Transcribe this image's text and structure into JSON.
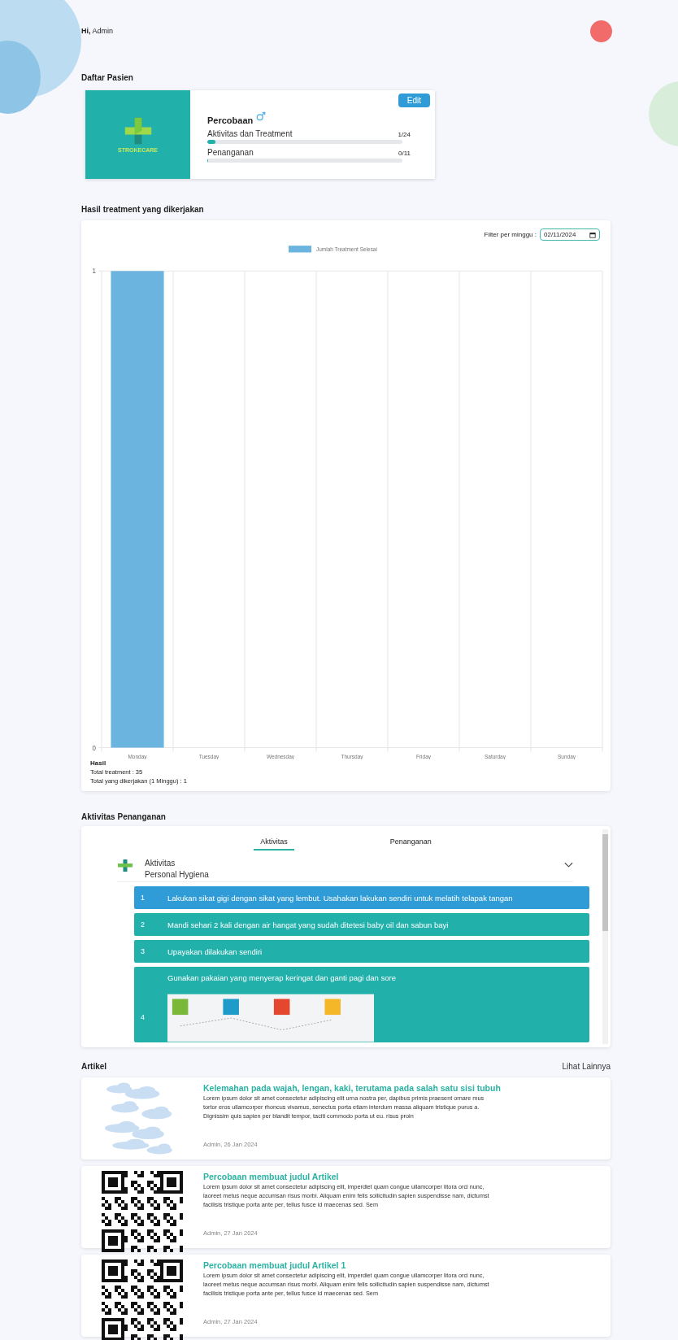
{
  "header": {
    "greeting": "Hi,",
    "user": "Admin"
  },
  "patients": {
    "title": "Daftar Pasien",
    "cards": [
      {
        "name": "Percobaan",
        "edit": "Edit",
        "logo_text": "STROKECARE",
        "progress": [
          {
            "label": "Aktivitas dan Treatment",
            "count": "1/24",
            "level": 0.04
          },
          {
            "label": "Penanganan",
            "count": "0/11",
            "level": 0
          }
        ]
      }
    ]
  },
  "results": {
    "title": "Hasil treatment yang dikerjakan",
    "filter_label": "Filter per minggu :",
    "filter_value": "02/11/2024",
    "chart_data": {
      "type": "bar",
      "categories": [
        "Monday",
        "Tuesday",
        "Wednesday",
        "Thursday",
        "Friday",
        "Saturday",
        "Sunday"
      ],
      "series": [
        {
          "name": "Jumlah Treatment Selesai",
          "color": "#6cb4e0",
          "values": [
            1,
            0,
            0,
            0,
            0,
            0,
            0
          ]
        }
      ],
      "ylim": [
        0,
        1
      ],
      "yticks": [
        0,
        1
      ]
    },
    "summary_title": "Hasil",
    "summary_lines": [
      "Total treatment : 35",
      "Total yang dikerjakan (1 Minggu) : 1"
    ]
  },
  "activities": {
    "title": "Aktivitas Penanganan",
    "tabs": [
      {
        "label": "Aktivitas",
        "selected": true
      },
      {
        "label": "Penanganan",
        "selected": false
      }
    ],
    "group": {
      "category": "Aktivitas",
      "name": "Personal Hygiena",
      "items": [
        {
          "number": "1",
          "text": "Lakukan sikat gigi dengan sikat yang lembut. Usahakan lakukan sendiri untuk melatih telapak tangan",
          "selected": true,
          "kind": "text"
        },
        {
          "number": "2",
          "text": "Mandi sehari 2 kali dengan air hangat yang sudah ditetesi baby oil dan sabun bayi",
          "selected": false,
          "kind": "text"
        },
        {
          "number": "3",
          "text": "Upayakan dilakukan sendiri",
          "selected": false,
          "kind": "text"
        },
        {
          "number": "4",
          "text": "Gunakan pakaian yang menyerap keringat dan ganti pagi dan sore",
          "selected": false,
          "kind": "image"
        }
      ]
    }
  },
  "articles": {
    "title": "Artikel",
    "more": "Lihat Lainnya",
    "items": [
      {
        "kind": "clouds",
        "title": "Kelemahan pada wajah, lengan, kaki, terutama pada salah satu sisi tubuh",
        "excerpt": "Lorem ipsum dolor sit amet consectetur adipiscing elit urna nostra per, dapibus primis praesent ornare mus tortor eros ullamcorper rhoncus vivamus, senectus porta etiam interdum massa aliquam tristique purus a. Dignissim quis sapien per blandit tempor, taciti commodo porta ut eu. risus proin",
        "meta": "Admin, 26 Jan 2024"
      },
      {
        "kind": "qr",
        "title": "Percobaan membuat judul Artikel",
        "excerpt": "Lorem ipsum dolor sit amet consectetur adipiscing elit, imperdiet quam congue ullamcorper litora orci nunc, laoreet metus neque accumsan risus morbi. Aliquam enim felis sollicitudin sapien suspendisse nam, dictumst facilisis tristique porta ante per, tellus fusce id maecenas sed. Sem",
        "meta": "Admin, 27 Jan 2024"
      },
      {
        "kind": "qr",
        "title": "Percobaan membuat judul Artikel 1",
        "excerpt": "Lorem ipsum dolor sit amet consectetur adipiscing elit, imperdiet quam congue ullamcorper litora orci nunc, laoreet metus neque accumsan risus morbi. Aliquam enim felis sollicitudin sapien suspendisse nam, dictumst facilisis tristique porta ante per, tellus fusce id maecenas sed. Sem",
        "meta": "Admin, 27 Jan 2024"
      }
    ]
  }
}
